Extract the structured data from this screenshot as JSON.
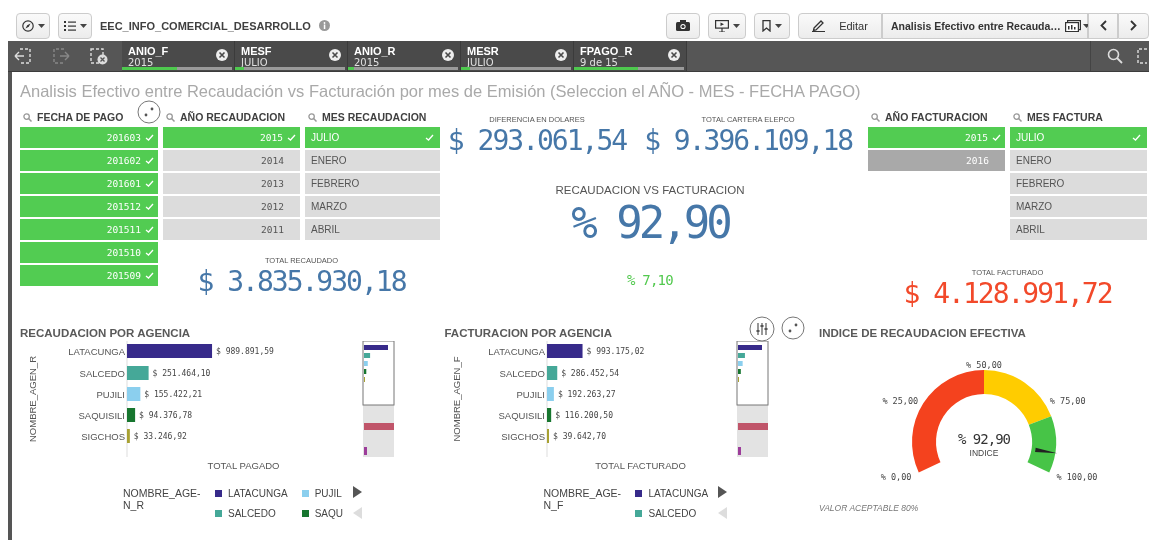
{
  "toolbar": {
    "app_title": "EEC_INFO_COMERCIAL_DESARROLLO",
    "edit_label": "Editar",
    "sheet_menu": "Analisis Efectivo entre Recauda…"
  },
  "selections": [
    {
      "field": "ANIO_F",
      "value": "2015",
      "level": 0.5
    },
    {
      "field": "MESF",
      "value": "JULIO",
      "level": 0.08
    },
    {
      "field": "ANIO_R",
      "value": "2015",
      "level": 0.05
    },
    {
      "field": "MESR",
      "value": "JULIO",
      "level": 0.08
    },
    {
      "field": "FPAGO_R",
      "value": "9 de 15",
      "level": 0.58
    }
  ],
  "sheet_title": "Analisis Efectivo entre Recaudación vs Facturación por mes de Emisión (Seleccion el AÑO - MES - FECHA PAGO)",
  "recaudacion_filters": [
    {
      "title": "FECHA DE PAGO",
      "kind": "numeric",
      "items": [
        {
          "label": "201603",
          "selected": true,
          "excluded": false
        },
        {
          "label": "201602",
          "selected": true,
          "excluded": false
        },
        {
          "label": "201601",
          "selected": true,
          "excluded": false
        },
        {
          "label": "201512",
          "selected": true,
          "excluded": false
        },
        {
          "label": "201511",
          "selected": true,
          "excluded": false
        },
        {
          "label": "201510",
          "selected": true,
          "excluded": false
        },
        {
          "label": "201509",
          "selected": true,
          "excluded": false
        }
      ]
    },
    {
      "title": "AÑO RECAUDACION",
      "kind": "numeric",
      "items": [
        {
          "label": "2015",
          "selected": true,
          "excluded": false
        },
        {
          "label": "2014",
          "selected": false,
          "excluded": false
        },
        {
          "label": "2013",
          "selected": false,
          "excluded": false
        },
        {
          "label": "2012",
          "selected": false,
          "excluded": false
        },
        {
          "label": "2011",
          "selected": false,
          "excluded": false
        }
      ]
    },
    {
      "title": "MES RECAUDACION",
      "kind": "text",
      "items": [
        {
          "label": "JULIO",
          "selected": true,
          "excluded": false
        },
        {
          "label": "ENERO",
          "selected": false,
          "excluded": false
        },
        {
          "label": "FEBRERO",
          "selected": false,
          "excluded": false
        },
        {
          "label": "MARZO",
          "selected": false,
          "excluded": false
        },
        {
          "label": "ABRIL",
          "selected": false,
          "excluded": false
        }
      ]
    }
  ],
  "total_recaudado": {
    "label": "TOTAL RECAUDADO",
    "value": "$ 3.835.930,18",
    "color": "#4677a8"
  },
  "diferencia": {
    "label": "DIFERENCIA EN DOLARES",
    "value": "$ 293.061,54",
    "color": "#4677a8"
  },
  "cartera": {
    "label": "TOTAL CARTERA ELEPCO",
    "value": "$ 9.396.109,18",
    "color": "#4677a8"
  },
  "ratio": {
    "label": "RECAUDACION VS FACTURACION",
    "value": "% 92,90",
    "color": "#4677a8"
  },
  "ratio_difference": {
    "value": "% 7,10",
    "color": "#52c94e"
  },
  "facturacion_filters": [
    {
      "title": "AÑO FACTURACION",
      "kind": "numeric",
      "items": [
        {
          "label": "2015",
          "selected": true,
          "excluded": false
        },
        {
          "label": "2016",
          "selected": false,
          "excluded": true
        }
      ]
    },
    {
      "title": "MES FACTURA",
      "kind": "text",
      "items": [
        {
          "label": "JULIO",
          "selected": true,
          "excluded": false
        },
        {
          "label": "ENERO",
          "selected": false,
          "excluded": false
        },
        {
          "label": "FEBRERO",
          "selected": false,
          "excluded": false
        },
        {
          "label": "MARZO",
          "selected": false,
          "excluded": false
        },
        {
          "label": "ABRIL",
          "selected": false,
          "excluded": false
        }
      ]
    }
  ],
  "total_facturado": {
    "label": "TOTAL FACTURADO",
    "value": "$ 4.128.991,72",
    "color": "#f2492a"
  },
  "recaudacion_chart": {
    "title": "RECAUDACION POR AGENCIA",
    "bars": [
      {
        "color": "#372a8a"
      },
      {
        "color": "#45a898"
      },
      {
        "color": "#8bcfee"
      },
      {
        "color": "#17762f"
      },
      {
        "color": "#a8a132"
      }
    ],
    "chart_data": {
      "type": "bar",
      "orientation": "horizontal",
      "xlabel": "TOTAL PAGADO",
      "ylabel": "NOMBRE_AGEN_R",
      "categories": [
        "LATACUNGA",
        "SALCEDO",
        "PUJILI",
        "SAQUISILI",
        "SIGCHOS"
      ],
      "values": [
        989891.59,
        251464.1,
        155422.21,
        94376.78,
        33246.92
      ],
      "value_labels": [
        "$ 989.891,59",
        "$ 251.464,10",
        "$ 155.422,21",
        "$ 94.376,78",
        "$ 33.246,92"
      ]
    },
    "legend": {
      "title": "NOMBRE_AGE-N_R",
      "items": [
        {
          "label": "LATACUNGA",
          "color": "#372a8a"
        },
        {
          "label": "SALCEDO",
          "color": "#45a898"
        },
        {
          "label": "PUJIL",
          "color": "#8bcfee"
        },
        {
          "label": "SAQU",
          "color": "#17762f"
        }
      ],
      "nav": [
        {
          "kind": "next",
          "disabled": false
        },
        {
          "kind": "prev",
          "disabled": true
        }
      ]
    }
  },
  "facturacion_chart": {
    "title": "FACTURACION POR AGENCIA",
    "bars": [
      {
        "color": "#372a8a"
      },
      {
        "color": "#45a898"
      },
      {
        "color": "#8bcfee"
      },
      {
        "color": "#17762f"
      },
      {
        "color": "#a8a132"
      }
    ],
    "chart_data": {
      "type": "bar",
      "orientation": "horizontal",
      "xlabel": "TOTAL FACTURADO",
      "ylabel": "NOMBRE_AGEN_F",
      "categories": [
        "LATACUNGA",
        "SALCEDO",
        "PUJILI",
        "SAQUISILI",
        "SIGCHOS"
      ],
      "values": [
        993175.02,
        286452.54,
        192263.27,
        116200.5,
        39642.7
      ],
      "value_labels": [
        "$ 993.175,02",
        "$ 286.452,54",
        "$ 192.263,27",
        "$ 116.200,50",
        "$ 39.642,70"
      ]
    },
    "legend": {
      "title": "NOMBRE_AGE-N_F",
      "items": [
        {
          "label": "LATACUNGA",
          "color": "#372a8a"
        },
        {
          "label": "SALCEDO",
          "color": "#45a898"
        }
      ],
      "nav": [
        {
          "kind": "next",
          "disabled": false
        },
        {
          "kind": "prev",
          "disabled": true
        }
      ]
    }
  },
  "gauge": {
    "title": "INDICE DE RECAUDACION EFECTIVA",
    "value": "% 92,90",
    "value_label": "INDICE",
    "ticks": [
      "% 0,00",
      "% 25,00",
      "% 50,00",
      "% 75,00",
      "% 100,00"
    ],
    "footnote": "VALOR ACEPTABLE 80%"
  }
}
